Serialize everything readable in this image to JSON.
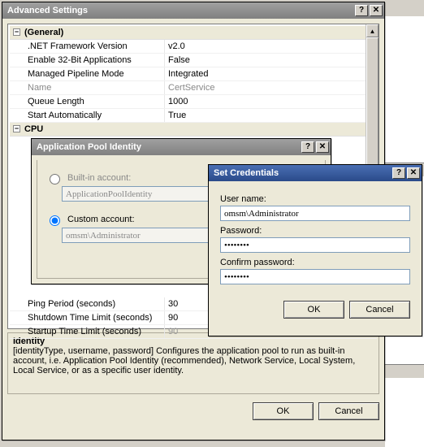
{
  "advanced": {
    "title": "Advanced Settings",
    "help_btn": "?",
    "close_btn": "✕",
    "categories": {
      "general": {
        "label": "(General)",
        "rows": [
          {
            "label": ".NET Framework Version",
            "value": "v2.0"
          },
          {
            "label": "Enable 32-Bit Applications",
            "value": "False"
          },
          {
            "label": "Managed Pipeline Mode",
            "value": "Integrated"
          },
          {
            "label": "Name",
            "value": "CertService",
            "dim": true
          },
          {
            "label": "Queue Length",
            "value": "1000"
          },
          {
            "label": "Start Automatically",
            "value": "True"
          }
        ]
      },
      "cpu": {
        "label": "CPU"
      },
      "process_model": {
        "rows_tail": [
          {
            "label": "Ping Period (seconds)",
            "value": "30"
          },
          {
            "label": "Shutdown Time Limit (seconds)",
            "value": "90"
          },
          {
            "label": "Startup Time Limit (seconds)",
            "value": "90"
          }
        ]
      }
    },
    "desc": {
      "heading": "Identity",
      "body": "[identityType, username, password] Configures the application pool to run as built-in account, i.e. Application Pool Identity (recommended), Network Service, Local System, Local Service, or as a specific user identity."
    },
    "buttons": {
      "ok": "OK",
      "cancel": "Cancel"
    }
  },
  "identity_dialog": {
    "title": "Application Pool Identity",
    "builtin_label": "Built-in account:",
    "builtin_value": "ApplicationPoolIdentity",
    "custom_label": "Custom account:",
    "custom_value": "omsm\\Administrator"
  },
  "credentials": {
    "title": "Set Credentials",
    "username_label": "User name:",
    "username_value": "omsm\\Administrator",
    "password_label": "Password:",
    "password_value": "••••••••",
    "confirm_label": "Confirm password:",
    "confirm_value": "••••••••",
    "ok": "OK",
    "cancel": "Cancel"
  }
}
